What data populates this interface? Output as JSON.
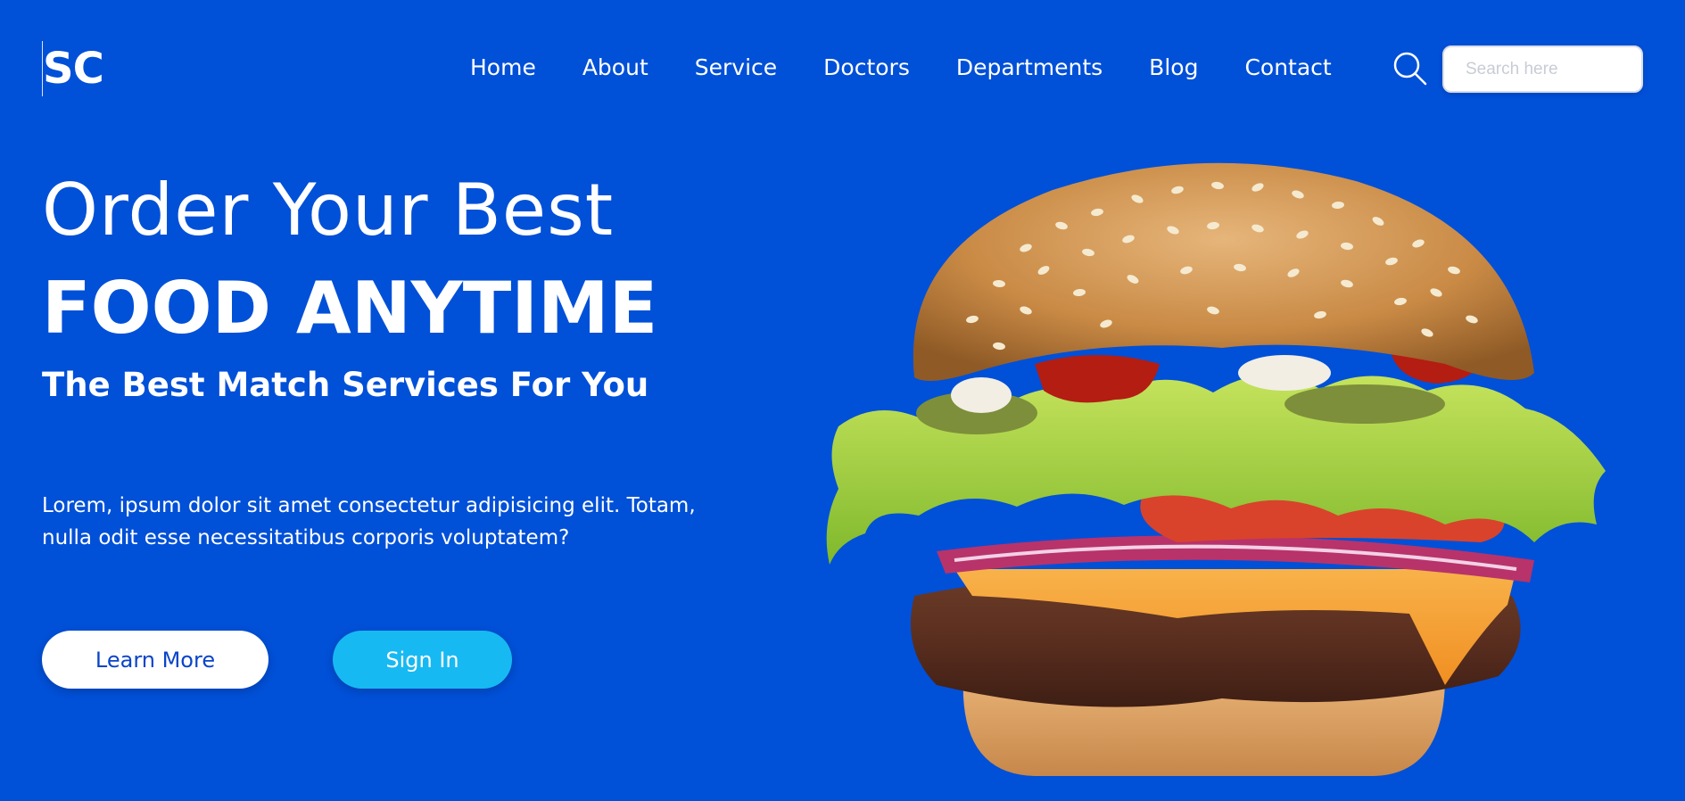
{
  "brand": {
    "logo_text": "SC"
  },
  "nav": {
    "items": [
      {
        "label": "Home"
      },
      {
        "label": "About"
      },
      {
        "label": "Service"
      },
      {
        "label": "Doctors"
      },
      {
        "label": "Departments"
      },
      {
        "label": "Blog"
      },
      {
        "label": "Contact"
      }
    ]
  },
  "search": {
    "placeholder": "Search here",
    "value": "",
    "icon": "search-icon"
  },
  "hero": {
    "line1": "Order Your Best",
    "line2": "FOOD ANYTIME",
    "line3": "The Best Match Services For You",
    "description": "Lorem, ipsum dolor sit amet consectetur adipisicing elit. Totam, nulla odit esse necessitatibus corporis voluptatem?",
    "image": "burger-image"
  },
  "buttons": {
    "learn_more": "Learn More",
    "sign_in": "Sign In"
  },
  "colors": {
    "background": "#0050d8",
    "text": "#ffffff",
    "learn_more_text": "#0a45c8",
    "sign_in_bg": "#17b9f2"
  }
}
